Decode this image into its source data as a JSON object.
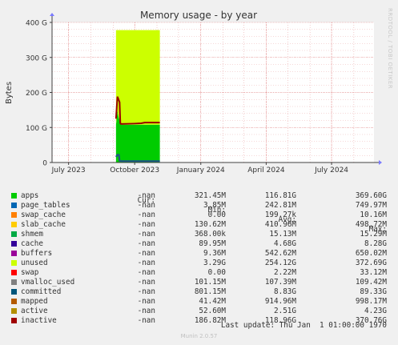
{
  "chart_data": {
    "type": "area",
    "title": "Memory usage - by year",
    "ylabel": "Bytes",
    "xlabel": "",
    "ylim": [
      0,
      400
    ],
    "y_unit": "G",
    "y_ticks": [
      0,
      100,
      200,
      300,
      400
    ],
    "y_tick_labels": [
      "0",
      "100 G",
      "200 G",
      "300 G",
      "400 G"
    ],
    "x_range": [
      "2023-06-08",
      "2024-08-29"
    ],
    "x_ticks": [
      "2023-07-01",
      "2023-10-01",
      "2024-01-01",
      "2024-04-01",
      "2024-07-01"
    ],
    "x_tick_labels": [
      "July 2023",
      "October 2023",
      "January 2024",
      "April 2024",
      "July 2024"
    ],
    "grid": true,
    "series": [
      {
        "name": "apps",
        "color": "#00cc00",
        "style": "stacked-area",
        "x": [
          "2023-09-05",
          "2023-09-06",
          "2023-09-07",
          "2023-09-08",
          "2023-09-10",
          "2023-09-11",
          "2023-09-12",
          "2023-09-30",
          "2023-10-20",
          "2023-11-05"
        ],
        "values": [
          108,
          128,
          148,
          135,
          120,
          110,
          108,
          108,
          108,
          108
        ]
      },
      {
        "name": "unused",
        "color": "#ccff00",
        "style": "stacked-area",
        "x": [
          "2023-09-05",
          "2023-11-05"
        ],
        "values": [
          270,
          270
        ]
      },
      {
        "name": "inactive",
        "color": "#990000",
        "style": "line",
        "x": [
          "2023-09-05",
          "2023-09-07",
          "2023-09-08",
          "2023-09-10",
          "2023-09-11",
          "2023-09-12",
          "2023-09-30",
          "2023-10-10",
          "2023-10-15",
          "2023-11-05"
        ],
        "values": [
          125,
          188,
          183,
          172,
          112,
          110,
          111,
          112,
          114,
          114
        ]
      },
      {
        "name": "committed",
        "color": "#1f4f8a",
        "style": "line",
        "x": [
          "2023-09-05",
          "2023-09-07",
          "2023-09-09",
          "2023-09-10",
          "2023-09-12",
          "2023-11-05"
        ],
        "values": [
          16,
          22,
          22,
          5,
          4,
          4
        ]
      }
    ]
  },
  "legend": {
    "headers": {
      "cur": "Cur:",
      "min": "Min:",
      "avg": "Avg:",
      "max": "Max:"
    },
    "rows": [
      {
        "name": "apps",
        "color": "#00cc00",
        "cur": "-nan",
        "min": "321.45M",
        "avg": "116.81G",
        "max": "369.60G"
      },
      {
        "name": "page_tables",
        "color": "#0066b3",
        "cur": "-nan",
        "min": "3.85M",
        "avg": "242.81M",
        "max": "749.97M"
      },
      {
        "name": "swap_cache",
        "color": "#ff8000",
        "cur": "-nan",
        "min": "0.00",
        "avg": "199.27k",
        "max": "10.16M"
      },
      {
        "name": "slab_cache",
        "color": "#ffcc00",
        "cur": "-nan",
        "min": "130.62M",
        "avg": "410.96M",
        "max": "498.72M"
      },
      {
        "name": "shmem",
        "color": "#00aa44",
        "cur": "-nan",
        "min": "368.00k",
        "avg": "15.13M",
        "max": "15.29M"
      },
      {
        "name": "cache",
        "color": "#330099",
        "cur": "-nan",
        "min": "89.95M",
        "avg": "4.68G",
        "max": "8.28G"
      },
      {
        "name": "buffers",
        "color": "#990099",
        "cur": "-nan",
        "min": "9.36M",
        "avg": "542.62M",
        "max": "650.02M"
      },
      {
        "name": "unused",
        "color": "#ccff00",
        "cur": "-nan",
        "min": "3.29G",
        "avg": "254.12G",
        "max": "372.69G"
      },
      {
        "name": "swap",
        "color": "#ff0000",
        "cur": "-nan",
        "min": "0.00",
        "avg": "2.22M",
        "max": "33.12M"
      },
      {
        "name": "vmalloc_used",
        "color": "#808080",
        "cur": "-nan",
        "min": "101.15M",
        "avg": "107.39M",
        "max": "109.42M"
      },
      {
        "name": "committed",
        "color": "#00557a",
        "cur": "-nan",
        "min": "801.15M",
        "avg": "8.83G",
        "max": "89.33G"
      },
      {
        "name": "mapped",
        "color": "#b35a00",
        "cur": "-nan",
        "min": "41.42M",
        "avg": "914.96M",
        "max": "998.17M"
      },
      {
        "name": "active",
        "color": "#b38f00",
        "cur": "-nan",
        "min": "52.60M",
        "avg": "2.51G",
        "max": "4.23G"
      },
      {
        "name": "inactive",
        "color": "#a00000",
        "cur": "-nan",
        "min": "186.82M",
        "avg": "118.96G",
        "max": "370.76G"
      }
    ]
  },
  "last_update": "Last update: Thu Jan  1 01:00:00 1970",
  "footer": "Munin 2.0.57",
  "watermark": "RRDTOOL / TOBI OETIKER",
  "colors": {
    "background": "#f0f0f0",
    "plot_background": "#ffffff",
    "grid": "#e08080",
    "axis": "#4040ff"
  }
}
